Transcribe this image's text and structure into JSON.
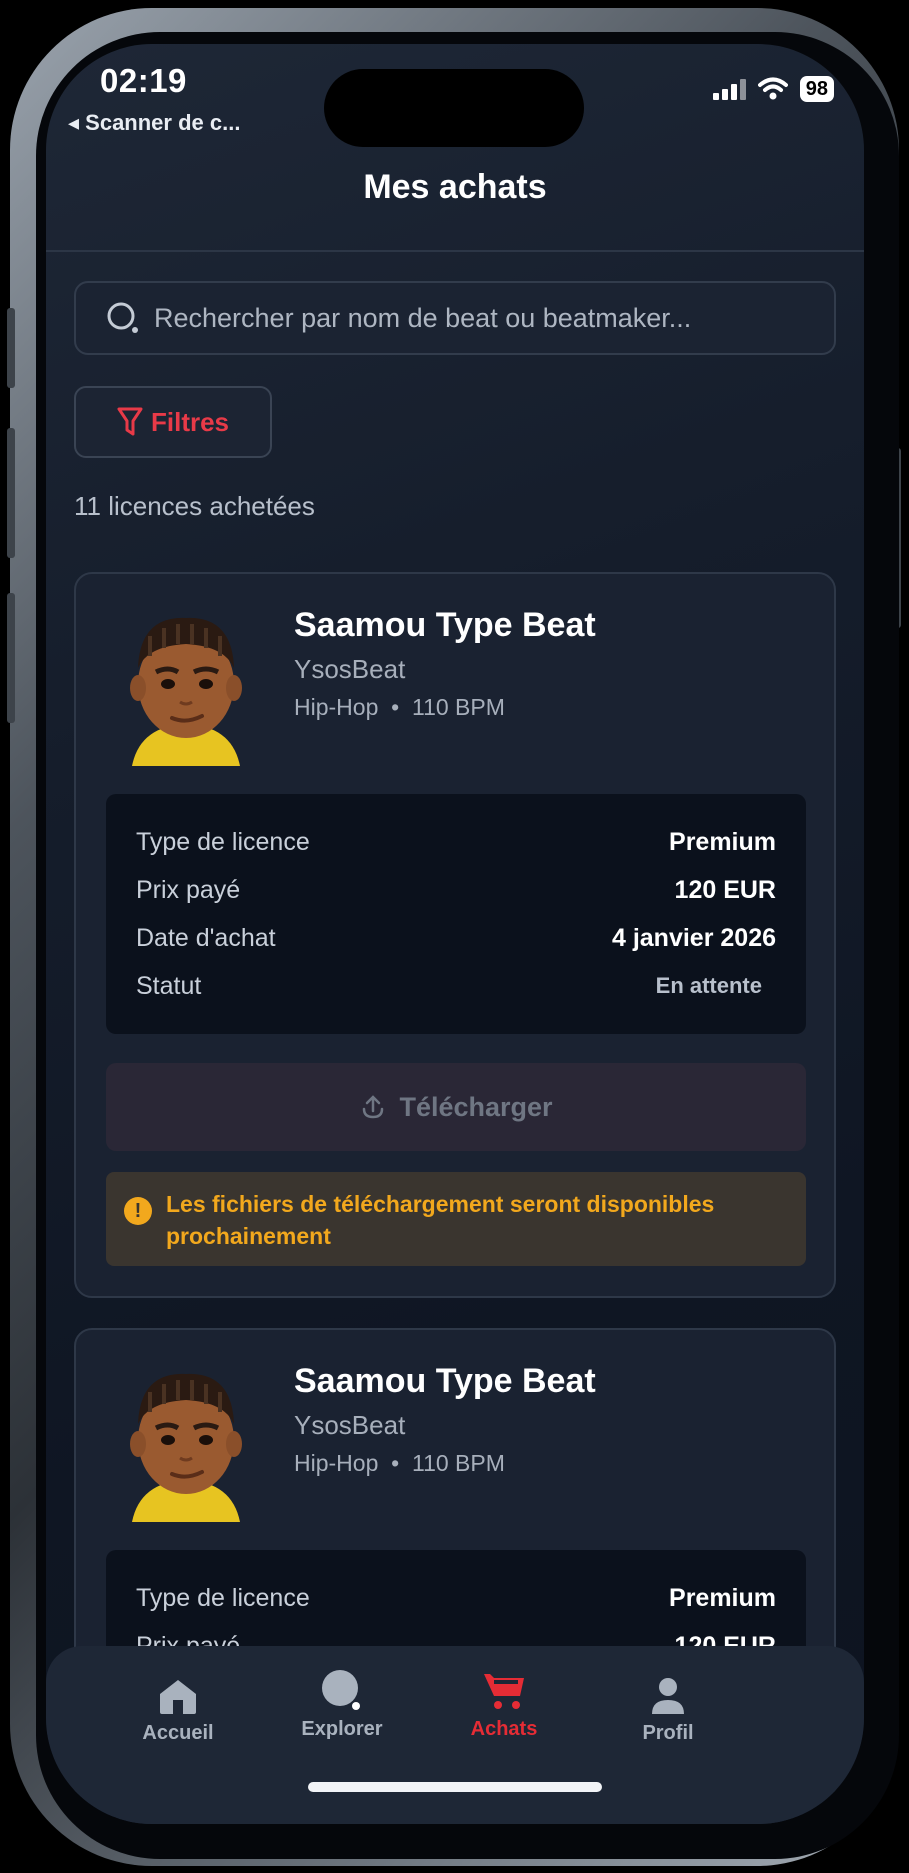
{
  "status": {
    "time": "02:19",
    "back_label": "◂ Scanner de c...",
    "battery": "98"
  },
  "page": {
    "title": "Mes achats"
  },
  "search": {
    "placeholder": "Rechercher par nom de beat ou beatmaker..."
  },
  "filters": {
    "label": "Filtres"
  },
  "summary": {
    "count_text": "11 licences achetées"
  },
  "labels": {
    "license_type": "Type de licence",
    "price_paid": "Prix payé",
    "purchase_date": "Date d'achat",
    "status": "Statut"
  },
  "purchases": [
    {
      "title": "Saamou Type Beat",
      "artist": "YsosBeat",
      "genre": "Hip-Hop",
      "bpm": "110 BPM",
      "license": "Premium",
      "price": "120 EUR",
      "date": "4 janvier 2026",
      "status": "En attente",
      "download_label": "Télécharger",
      "notice": "Les fichiers de téléchargement seront disponibles prochainement"
    },
    {
      "title": "Saamou Type Beat",
      "artist": "YsosBeat",
      "genre": "Hip-Hop",
      "bpm": "110 BPM",
      "license": "Premium",
      "price": "120 EUR"
    }
  ],
  "tabs": [
    {
      "label": "Accueil",
      "icon": "home-icon"
    },
    {
      "label": "Explorer",
      "icon": "explore-icon"
    },
    {
      "label": "Achats",
      "icon": "cart-icon",
      "active": true
    },
    {
      "label": "Profil",
      "icon": "profile-icon"
    }
  ],
  "colors": {
    "accent": "#e52c35",
    "warning": "#f2a81d",
    "background": "#141c2a"
  }
}
